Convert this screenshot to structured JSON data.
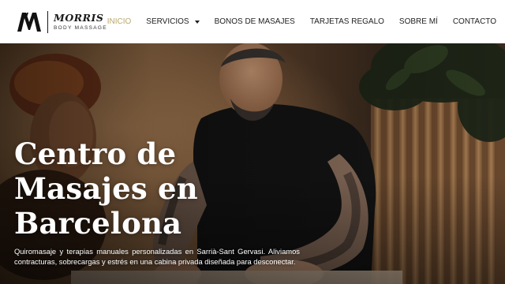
{
  "brand": {
    "name": "MORRIS",
    "tagline": "BODY MASSAGE"
  },
  "nav": {
    "items": [
      {
        "label": "INICIO",
        "active": true
      },
      {
        "label": "SERVICIOS",
        "has_dropdown": true
      },
      {
        "label": "BONOS DE MASAJES"
      },
      {
        "label": "TARJETAS REGALO"
      },
      {
        "label": "SOBRE MÍ"
      },
      {
        "label": "CONTACTO"
      }
    ]
  },
  "hero": {
    "title_lines": [
      "Centro de",
      "Masajes en",
      "Barcelona"
    ],
    "description": "Quiromasaje y terapias manuales personalizadas en Sarrià-Sant Gervasi. Aliviamos contracturas, sobrecargas y estrés en una cabina privada diseñada para desconectar."
  },
  "colors": {
    "accent": "#b8a86a",
    "text_dark": "#1f1f1f",
    "header_bg": "#ffffff"
  },
  "icons": {
    "logo": "mm-monogram-icon",
    "dropdown": "caret-down-icon"
  }
}
